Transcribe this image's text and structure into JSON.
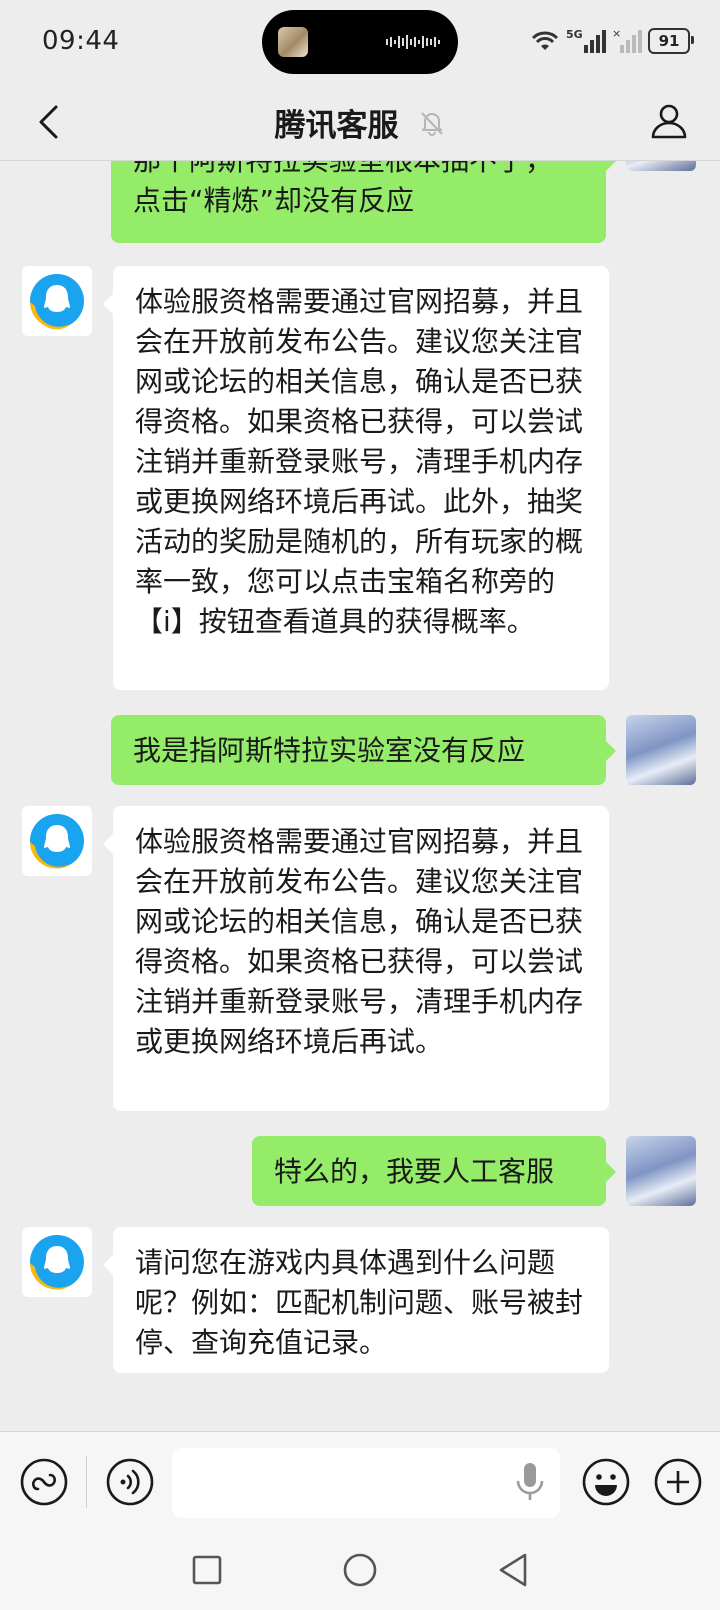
{
  "status_bar": {
    "time": "09:44",
    "battery": "91",
    "network": "5G"
  },
  "header": {
    "title": "腾讯客服"
  },
  "messages": [
    {
      "from": "user",
      "text": "那个阿斯特拉实验室根本抽不了，\n点击“精炼”却没有反应"
    },
    {
      "from": "bot",
      "text": "体验服资格需要通过官网招募，并且会在开放前发布公告。建议您关注官网或论坛的相关信息，确认是否已获得资格。如果资格已获得，可以尝试注销并重新登录账号，清理手机内存或更换网络环境后再试。此外，抽奖活动的奖励是随机的，所有玩家的概率一致，您可以点击宝箱名称旁的【i】按钮查看道具的获得概率。"
    },
    {
      "from": "user",
      "text": "我是指阿斯特拉实验室没有反应"
    },
    {
      "from": "bot",
      "text": "体验服资格需要通过官网招募，并且会在开放前发布公告。建议您关注官网或论坛的相关信息，确认是否已获得资格。如果资格已获得，可以尝试注销并重新登录账号，清理手机内存或更换网络环境后再试。"
    },
    {
      "from": "user",
      "text": "特么的，我要人工客服"
    },
    {
      "from": "bot",
      "text": "请问您在游戏内具体遇到什么问题呢？例如：匹配机制问题、账号被封停、查询充值记录。"
    }
  ],
  "input": {
    "placeholder": "",
    "value": ""
  },
  "colors": {
    "user_bubble": "#95ec69",
    "bot_bubble": "#ffffff",
    "background": "#ededed",
    "bot_logo_blue": "#1aa3ee",
    "bot_logo_yellow": "#f8b90c"
  }
}
